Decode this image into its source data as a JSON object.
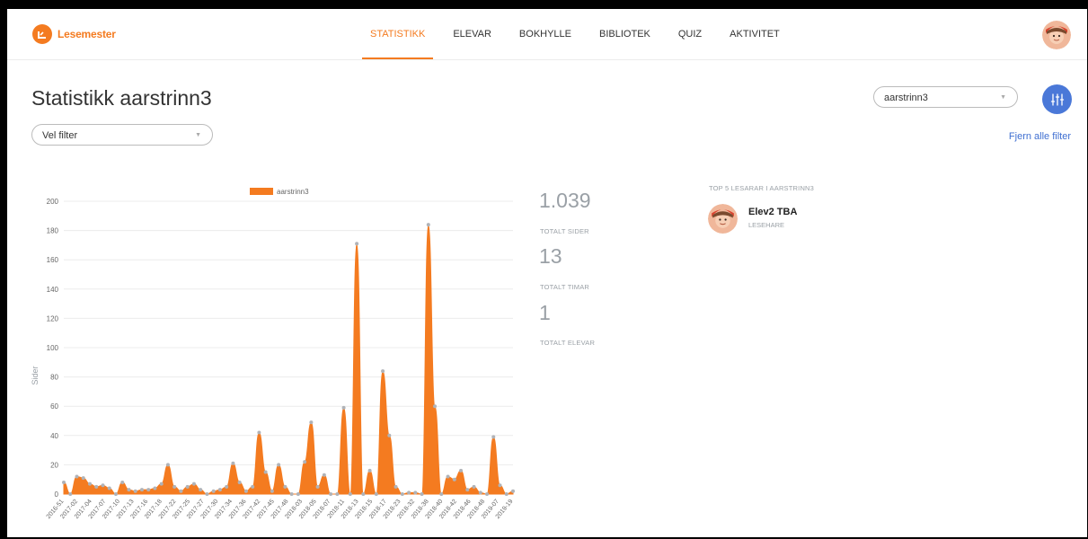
{
  "app": {
    "logo_text": "Lesemester"
  },
  "nav": {
    "items": [
      {
        "label": "STATISTIKK",
        "active": true
      },
      {
        "label": "ELEVAR",
        "active": false
      },
      {
        "label": "BOKHYLLE",
        "active": false
      },
      {
        "label": "BIBLIOTEK",
        "active": false
      },
      {
        "label": "QUIZ",
        "active": false
      },
      {
        "label": "AKTIVITET",
        "active": false
      }
    ]
  },
  "page": {
    "title": "Statistikk aarstrinn3",
    "grade_select": "aarstrinn3",
    "filter_select": "Vel filter",
    "clear_filters": "Fjern alle filter"
  },
  "stats": [
    {
      "value": "1.039",
      "label": "TOTALT SIDER"
    },
    {
      "value": "13",
      "label": "TOTALT TIMAR"
    },
    {
      "value": "1",
      "label": "TOTALT ELEVAR"
    }
  ],
  "top_readers": {
    "title": "TOP 5 LESARAR I AARSTRINN3",
    "items": [
      {
        "name": "Elev2 TBA",
        "level": "LESEHARE"
      }
    ]
  },
  "colors": {
    "accent": "#f47b20",
    "blue": "#4a78d8",
    "muted": "#9aa0a6"
  },
  "icons": {
    "filter": "sliders-icon",
    "logo": "logo-icon",
    "avatar": "user-avatar-icon"
  },
  "chart_data": {
    "type": "area",
    "legend": "aarstrinn3",
    "ylabel": "Sider",
    "ylim": [
      0,
      200
    ],
    "yticks": [
      0,
      20,
      40,
      60,
      80,
      100,
      120,
      140,
      160,
      180,
      200
    ],
    "xticklabels": [
      "2016-51",
      "2017-02",
      "2017-04",
      "2017-07",
      "2017-10",
      "2017-13",
      "2017-16",
      "2017-18",
      "2017-22",
      "2017-25",
      "2017-27",
      "2017-30",
      "2017-34",
      "2017-36",
      "2017-42",
      "2017-45",
      "2017-48",
      "2018-03",
      "2018-05",
      "2018-07",
      "2018-11",
      "2018-13",
      "2018-15",
      "2018-17",
      "2018-23",
      "2018-32",
      "2018-38",
      "2018-40",
      "2018-42",
      "2018-46",
      "2018-48",
      "2019-07",
      "2019-19"
    ],
    "values": [
      8,
      0,
      12,
      11,
      7,
      5,
      6,
      4,
      0,
      8,
      3,
      2,
      3,
      3,
      4,
      7,
      20,
      5,
      2,
      5,
      7,
      3,
      0,
      2,
      3,
      5,
      21,
      8,
      2,
      5,
      42,
      15,
      2,
      20,
      5,
      0,
      0,
      22,
      49,
      5,
      13,
      0,
      0,
      59,
      0,
      171,
      0,
      16,
      0,
      84,
      40,
      5,
      0,
      1,
      1,
      0,
      184,
      60,
      0,
      12,
      10,
      16,
      3,
      5,
      1,
      0,
      39,
      6,
      0,
      2
    ]
  }
}
